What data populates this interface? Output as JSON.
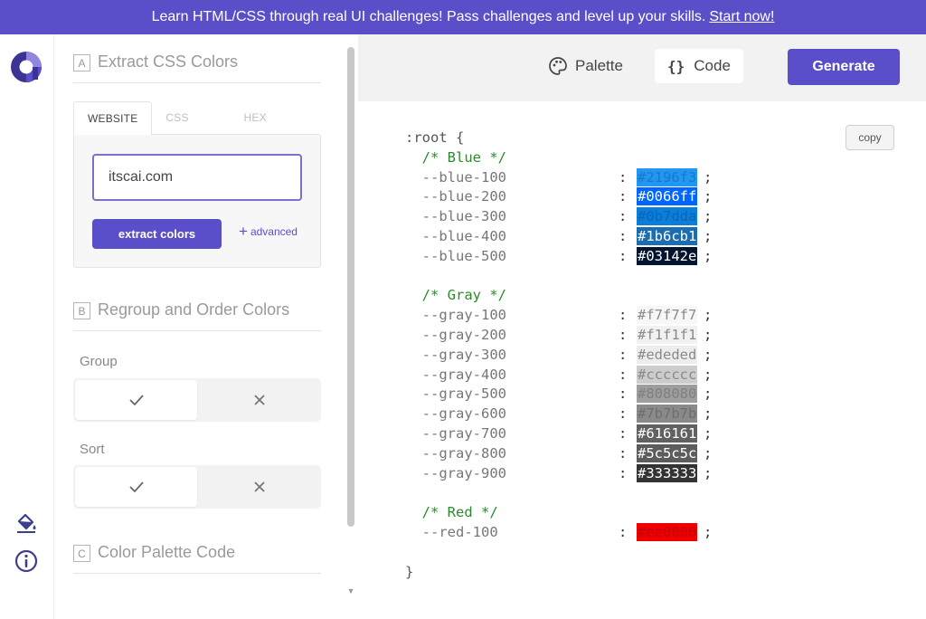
{
  "banner": {
    "text": "Learn HTML/CSS through real UI challenges! Pass challenges and level up your skills.",
    "link": "Start now!"
  },
  "sections": {
    "a": {
      "letter": "A",
      "title": "Extract CSS Colors"
    },
    "b": {
      "letter": "B",
      "title": "Regroup and Order Colors"
    },
    "c": {
      "letter": "C",
      "title": "Color Palette Code"
    }
  },
  "extract": {
    "tabs": [
      "WEBSITE",
      "CSS CODE",
      "HEX COLORS"
    ],
    "active_tab": "WEBSITE",
    "input_value": "itscai.com",
    "button": "extract colors",
    "advanced": "advanced"
  },
  "group": {
    "label": "Group"
  },
  "sort": {
    "label": "Sort"
  },
  "topbar": {
    "palette": "Palette",
    "code": "Code",
    "code_icon": "{}",
    "generate": "Generate"
  },
  "copy": "copy",
  "code": {
    "open": ":root {",
    "close": "}",
    "groups": [
      {
        "comment": "/* Blue */",
        "vars": [
          {
            "name": "--blue-100",
            "value": "#2196f3",
            "bg": "#2196f3",
            "fg": "#1a79c4"
          },
          {
            "name": "--blue-200",
            "value": "#0066ff",
            "bg": "#0066ff",
            "fg": "#ffffff"
          },
          {
            "name": "--blue-300",
            "value": "#0b7dda",
            "bg": "#0b7dda",
            "fg": "#0a66b2"
          },
          {
            "name": "--blue-400",
            "value": "#1b6cb1",
            "bg": "#1b6cb1",
            "fg": "#ffffff"
          },
          {
            "name": "--blue-500",
            "value": "#03142e",
            "bg": "#03142e",
            "fg": "#ffffff"
          }
        ]
      },
      {
        "comment": "/* Gray */",
        "vars": [
          {
            "name": "--gray-100",
            "value": "#f7f7f7",
            "bg": "#f7f7f7",
            "fg": "#8a8a8a"
          },
          {
            "name": "--gray-200",
            "value": "#f1f1f1",
            "bg": "#f1f1f1",
            "fg": "#8a8a8a"
          },
          {
            "name": "--gray-300",
            "value": "#ededed",
            "bg": "#ededed",
            "fg": "#8a8a8a"
          },
          {
            "name": "--gray-400",
            "value": "#cccccc",
            "bg": "#cccccc",
            "fg": "#8a8a8a"
          },
          {
            "name": "--gray-500",
            "value": "#808080",
            "bg": "#9e9e9e",
            "fg": "#808080"
          },
          {
            "name": "--gray-600",
            "value": "#7b7b7b",
            "bg": "#8a8a8a",
            "fg": "#6e6e6e"
          },
          {
            "name": "--gray-700",
            "value": "#616161",
            "bg": "#616161",
            "fg": "#ffffff"
          },
          {
            "name": "--gray-800",
            "value": "#5c5c5c",
            "bg": "#5c5c5c",
            "fg": "#ffffff"
          },
          {
            "name": "--gray-900",
            "value": "#333333",
            "bg": "#333333",
            "fg": "#ffffff"
          }
        ]
      },
      {
        "comment": "/* Red */",
        "vars": [
          {
            "name": "--red-100",
            "value": "#ee0000",
            "bg": "#ee0000",
            "fg": "#c40000"
          }
        ]
      }
    ]
  },
  "colors": {
    "brand": "#5b4fc9",
    "comment": "#2b8a2b"
  }
}
